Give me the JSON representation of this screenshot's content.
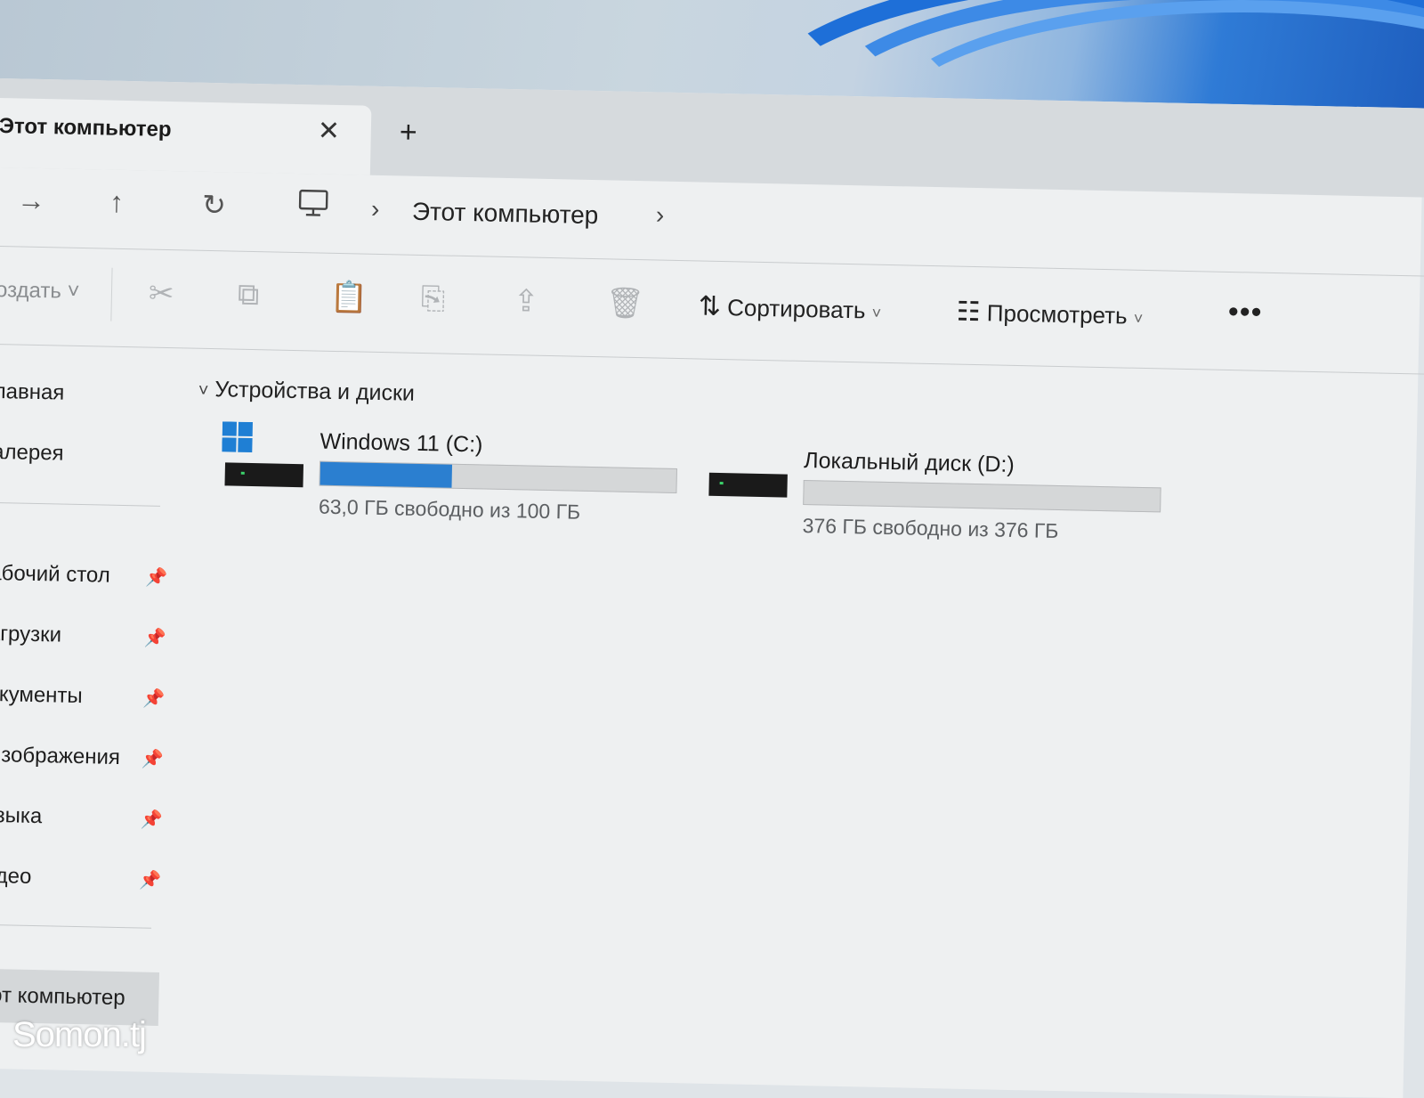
{
  "colors": {
    "accent": "#1e6fd8",
    "drive_c_fill": "#2b7fd0",
    "drive_d_fill": "#d5d7d8"
  },
  "window": {
    "tab_title": "Этот компьютер",
    "tab_close_icon": "close-icon",
    "new_tab_icon": "plus-icon"
  },
  "navigation": {
    "forward_icon": "arrow-right-icon",
    "up_icon": "arrow-up-icon",
    "refresh_icon": "refresh-icon",
    "location_icon": "monitor-icon",
    "breadcrumb": "Этот компьютер"
  },
  "toolbar": {
    "create_label": "оздать",
    "sort_label": "Сортировать",
    "view_label": "Просмотреть",
    "more_icon": "more-icon"
  },
  "sidebar": {
    "top_items": [
      {
        "label": "лавная"
      },
      {
        "label": "алерея"
      }
    ],
    "pinned_items": [
      {
        "label": "абочий стол"
      },
      {
        "label": "агрузки"
      },
      {
        "label": "окументы"
      },
      {
        "label": "Изображения"
      },
      {
        "label": "узыка"
      },
      {
        "label": "идео"
      }
    ],
    "this_pc_label": "тот компьютер"
  },
  "content": {
    "section_title": "Устройства и диски",
    "drives": [
      {
        "name": "Windows 11 (C:)",
        "free_text": "63,0 ГБ свободно из 100 ГБ",
        "used_fraction": 0.37
      },
      {
        "name": "Локальный диск (D:)",
        "free_text": "376 ГБ свободно из 376 ГБ",
        "used_fraction": 0.0
      }
    ]
  },
  "watermark": "Somon.tj"
}
